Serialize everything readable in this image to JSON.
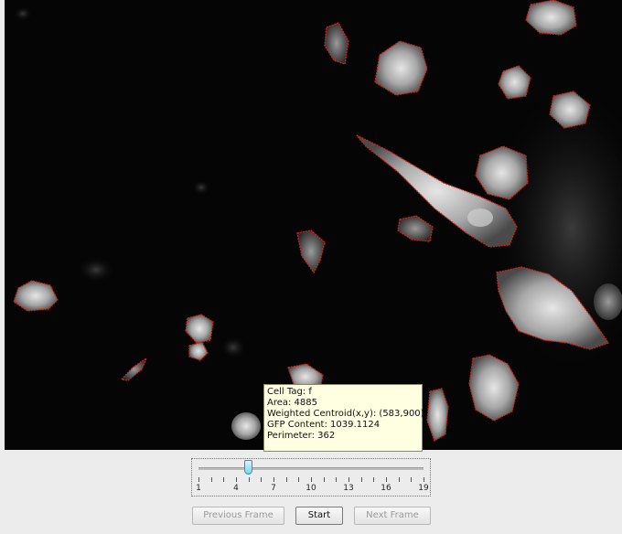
{
  "tooltip": {
    "cell_tag": "Cell Tag: f",
    "area": "Area: 4885",
    "centroid": "Weighted Centroid(x,y): (583,900)",
    "gfp": "GFP Content: 1039.1124",
    "perimeter": "Perimeter: 362"
  },
  "slider": {
    "value": 5,
    "min": 1,
    "max": 19,
    "tick_labels": [
      "1",
      "4",
      "7",
      "10",
      "13",
      "16",
      "19"
    ]
  },
  "buttons": {
    "previous": "Previous Frame",
    "start": "Start",
    "next": "Next Frame"
  },
  "colors": {
    "outline": "#d42020",
    "background": "#050505"
  }
}
